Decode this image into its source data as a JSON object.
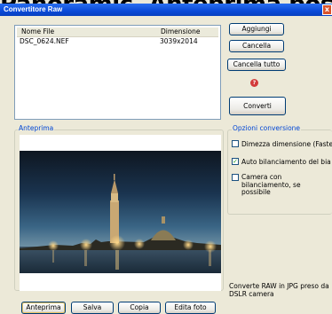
{
  "background_text": "Panoramic, Anteprima poss",
  "window": {
    "title": "Convertitore Raw",
    "close_glyph": "x"
  },
  "file_list": {
    "columns": [
      "Nome File",
      "Dimensione"
    ],
    "rows": [
      {
        "name": "DSC_0624.NEF",
        "size": "3039x2014"
      }
    ]
  },
  "buttons": {
    "add": "Aggiungi",
    "delete": "Cancella",
    "delete_all": "Cancella tutto",
    "convert": "Converti"
  },
  "help_glyph": "?",
  "preview": {
    "label": "Anteprima"
  },
  "options": {
    "label": "Opzioni conversione",
    "halve_size": {
      "label": "Dimezza dimensione (Faste",
      "checked": false
    },
    "auto_wb": {
      "label": "Auto bilanciamento del bia",
      "checked": true
    },
    "camera_wb": {
      "label": "Camera con bilanciamento, se possibile",
      "checked": false
    }
  },
  "bottom_buttons": {
    "preview": "Anteprima",
    "save": "Salva",
    "copy": "Copia",
    "edit": "Edita foto"
  },
  "info_text": "Converte RAW in JPG preso da DSLR camera",
  "check_glyph": "✓",
  "colors": {
    "titlebar": "#0a4ad8",
    "group_label": "#0046d5",
    "background": "#ece9d8"
  }
}
